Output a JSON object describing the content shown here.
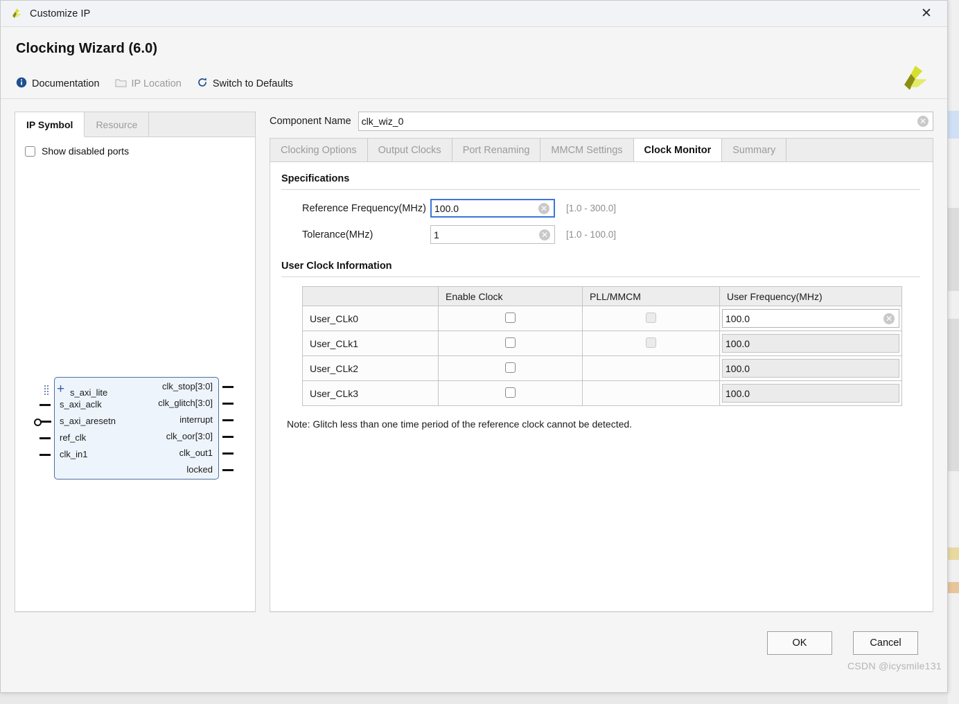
{
  "window": {
    "title": "Customize IP",
    "close_label": "✕",
    "app_icon": "xilinx-logo-icon"
  },
  "header": {
    "title": "Clocking Wizard (6.0)",
    "logo": "xilinx-logo-icon",
    "toolbar": [
      {
        "label": "Documentation",
        "icon": "info-icon",
        "disabled": false
      },
      {
        "label": "IP Location",
        "icon": "folder-icon",
        "disabled": true
      },
      {
        "label": "Switch to Defaults",
        "icon": "refresh-icon",
        "disabled": false
      }
    ]
  },
  "left_panel": {
    "tabs": [
      {
        "label": "IP Symbol",
        "active": true
      },
      {
        "label": "Resource",
        "active": false
      }
    ],
    "show_disabled_ports": {
      "label": "Show disabled ports",
      "checked": false
    },
    "symbol": {
      "inputs": [
        {
          "label": "s_axi_lite",
          "type": "bus"
        },
        {
          "label": "s_axi_aclk",
          "type": "clock"
        },
        {
          "label": "s_axi_aresetn",
          "type": "reset"
        },
        {
          "label": "ref_clk",
          "type": "clock"
        },
        {
          "label": "clk_in1",
          "type": "clock"
        }
      ],
      "outputs": [
        {
          "label": "clk_stop[3:0]"
        },
        {
          "label": "clk_glitch[3:0]"
        },
        {
          "label": "interrupt"
        },
        {
          "label": "clk_oor[3:0]"
        },
        {
          "label": "clk_out1"
        },
        {
          "label": "locked"
        }
      ]
    }
  },
  "component_name": {
    "label": "Component Name",
    "value": "clk_wiz_0",
    "clear_icon": "clear-circle-icon"
  },
  "tabs": [
    {
      "label": "Clocking Options",
      "active": false
    },
    {
      "label": "Output Clocks",
      "active": false
    },
    {
      "label": "Port Renaming",
      "active": false
    },
    {
      "label": "MMCM Settings",
      "active": false
    },
    {
      "label": "Clock Monitor",
      "active": true
    },
    {
      "label": "Summary",
      "active": false
    }
  ],
  "specifications": {
    "title": "Specifications",
    "fields": [
      {
        "label": "Reference Frequency(MHz)",
        "value": "100.0",
        "range": "[1.0 - 300.0]",
        "focused": true,
        "clear_icon": "clear-circle-icon"
      },
      {
        "label": "Tolerance(MHz)",
        "value": "1",
        "range": "[1.0 - 100.0]",
        "focused": false,
        "clear_icon": "clear-circle-icon"
      }
    ]
  },
  "user_clock_information": {
    "title": "User Clock Information",
    "columns": [
      "",
      "Enable Clock",
      "PLL/MMCM",
      "User Frequency(MHz)"
    ],
    "rows": [
      {
        "name": "User_CLk0",
        "enable_clock": false,
        "pll_mmcm": false,
        "pll_present": true,
        "frequency": "100.0",
        "freq_editable": true
      },
      {
        "name": "User_CLk1",
        "enable_clock": false,
        "pll_mmcm": false,
        "pll_present": true,
        "frequency": "100.0",
        "freq_editable": false
      },
      {
        "name": "User_CLk2",
        "enable_clock": false,
        "pll_mmcm": false,
        "pll_present": false,
        "frequency": "100.0",
        "freq_editable": false
      },
      {
        "name": "User_CLk3",
        "enable_clock": false,
        "pll_mmcm": false,
        "pll_present": false,
        "frequency": "100.0",
        "freq_editable": false
      }
    ],
    "note": "Note: Glitch less than one time period of the reference clock cannot be detected."
  },
  "footer": {
    "ok_label": "OK",
    "cancel_label": "Cancel",
    "watermark": "CSDN @icysmile131"
  },
  "colors": {
    "accent_focus": "#3a76d8",
    "symbol_border": "#4a6f9e",
    "symbol_fill": "#eef4fb",
    "logo_light": "#d6e02c",
    "logo_dark": "#8b8f10"
  }
}
